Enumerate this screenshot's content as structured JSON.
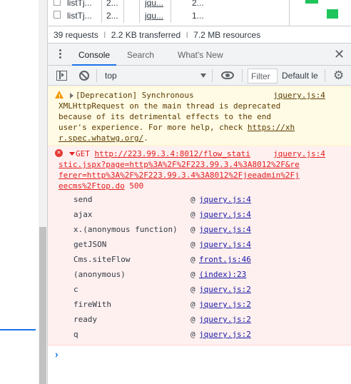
{
  "network": {
    "rows": [
      {
        "name": "listTj...",
        "c1": "2...",
        "c2": "",
        "c3": "jqu...",
        "c4": "2..."
      },
      {
        "name": "listTj...",
        "c1": "2...",
        "c2": "",
        "c3": "jqu...",
        "c4": "1..."
      }
    ],
    "summary": {
      "requests": "39 requests",
      "transferred": "2.2 KB transferred",
      "resources": "7.2 MB resources",
      "divider": "I"
    }
  },
  "drawer": {
    "tabs": [
      {
        "label": "Console",
        "active": true
      },
      {
        "label": "Search",
        "active": false
      },
      {
        "label": "What's New",
        "active": false
      }
    ],
    "close_glyph": "✕"
  },
  "toolbar": {
    "context": "top",
    "filter_placeholder": "Filter",
    "levels": "Default le",
    "gear_glyph": "⚙"
  },
  "warning": {
    "lines": [
      "[Deprecation] Synchronous",
      "XMLHttpRequest on the main thread is deprecated",
      "because of its detrimental effects to the end",
      "user's experience. For more help, check "
    ],
    "link_part1": "https://xh",
    "link_part2": "r.spec.whatwg.org/",
    "link_tail": ".",
    "source": "jquery.js:4"
  },
  "error": {
    "method": "GET ",
    "url_lines": [
      "http://223.99.3.4:8012/flow_stati",
      "stic.jspx?page=http%3A%2F%2F223.99.3.4%3A8012%2F&re",
      "ferer=http%3A%2F%2F223.99.3.4%3A8012%2Fjeeadmin%2Fj",
      "eecms%2Ftop.do"
    ],
    "status": "500",
    "source": "jquery.js:4",
    "icon": "✕",
    "stack": [
      {
        "fn": "send",
        "loc": "jquery.js:4"
      },
      {
        "fn": "ajax",
        "loc": "jquery.js:4"
      },
      {
        "fn": "x.(anonymous function)",
        "loc": "jquery.js:4"
      },
      {
        "fn": "getJSON",
        "loc": "jquery.js:4"
      },
      {
        "fn": "Cms.siteFlow",
        "loc": "front.js:46"
      },
      {
        "fn": "(anonymous)",
        "loc": "(index):23"
      },
      {
        "fn": "c",
        "loc": "jquery.js:2"
      },
      {
        "fn": "fireWith",
        "loc": "jquery.js:2"
      },
      {
        "fn": "ready",
        "loc": "jquery.js:2"
      },
      {
        "fn": "q",
        "loc": "jquery.js:2"
      }
    ],
    "at_symbol": "@"
  },
  "console": {
    "prompt": "›"
  },
  "colors": {
    "accent": "#1a73e8",
    "warning_bg": "#fffbe5",
    "error_bg": "#fff0f0",
    "error_text": "#e01e1e",
    "waterfall_bar": "#1fc45a"
  }
}
